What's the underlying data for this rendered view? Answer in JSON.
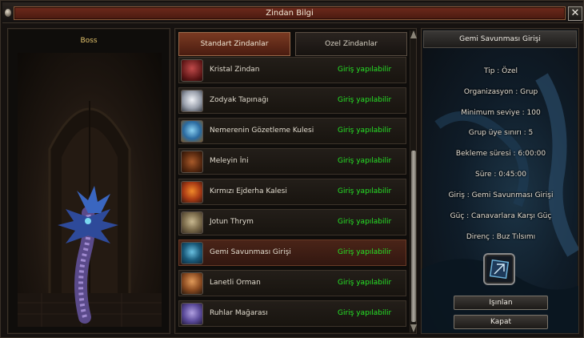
{
  "window": {
    "title": "Zindan Bilgi",
    "close_glyph": "✕"
  },
  "left_panel": {
    "label": "Boss"
  },
  "tabs": [
    {
      "label": "Standart Zindanlar",
      "active": true
    },
    {
      "label": "Ozel Zindanlar",
      "active": false
    }
  ],
  "dungeons": [
    {
      "name": "Kristal Zindan",
      "status": "Giriş yapılabilir",
      "icon": "crystal-dungeon-icon",
      "color": "#8a2a2a"
    },
    {
      "name": "Zodyak Tapınağı",
      "status": "Giriş yapılabilir",
      "icon": "zodiac-temple-icon",
      "color": "#c8ccd4"
    },
    {
      "name": "Nemerenin Gözetleme Kulesi",
      "status": "Giriş yapılabilir",
      "icon": "nemere-tower-icon",
      "color": "#3a7ab0"
    },
    {
      "name": "Meleyin İni",
      "status": "Giriş yapılabilir",
      "icon": "meley-lair-icon",
      "color": "#7a3a1a"
    },
    {
      "name": "Kırmızı Ejderha Kalesi",
      "status": "Giriş yapılabilir",
      "icon": "red-dragon-castle-icon",
      "color": "#b04a1a"
    },
    {
      "name": "Jotun Thrym",
      "status": "Giriş yapılabilir",
      "icon": "jotun-thrym-icon",
      "color": "#8a7a5a"
    },
    {
      "name": "Gemi Savunması Girişi",
      "status": "Giriş yapılabilir",
      "icon": "ship-defense-icon",
      "color": "#2a6a8a",
      "selected": true
    },
    {
      "name": "Lanetli Orman",
      "status": "Giriş yapılabilir",
      "icon": "cursed-forest-icon",
      "color": "#a85a2a"
    },
    {
      "name": "Ruhlar Mağarası",
      "status": "Giriş yapılabilir",
      "icon": "spirit-cave-icon",
      "color": "#6a5aa0"
    }
  ],
  "details": {
    "header": "Gemi Savunması Girişi",
    "lines": [
      "Tip : Özel",
      "Organizasyon : Grup",
      "Minimum seviye : 100",
      "Grup üye sınırı : 5",
      "Bekleme süresi : 6:00:00",
      "Süre : 0:45:00",
      "Giriş : Gemi Savunması Girişi",
      "Güç : Canavarlara Karşı Güç",
      "Direnç : Buz Tılsımı"
    ],
    "emblem_icon": "ice-talisman-icon",
    "teleport_label": "Işınlan",
    "close_label": "Kapat"
  },
  "colors": {
    "status_green": "#26e426",
    "boss_label": "#e2c26c",
    "title_plate": "#6e2a1c"
  }
}
